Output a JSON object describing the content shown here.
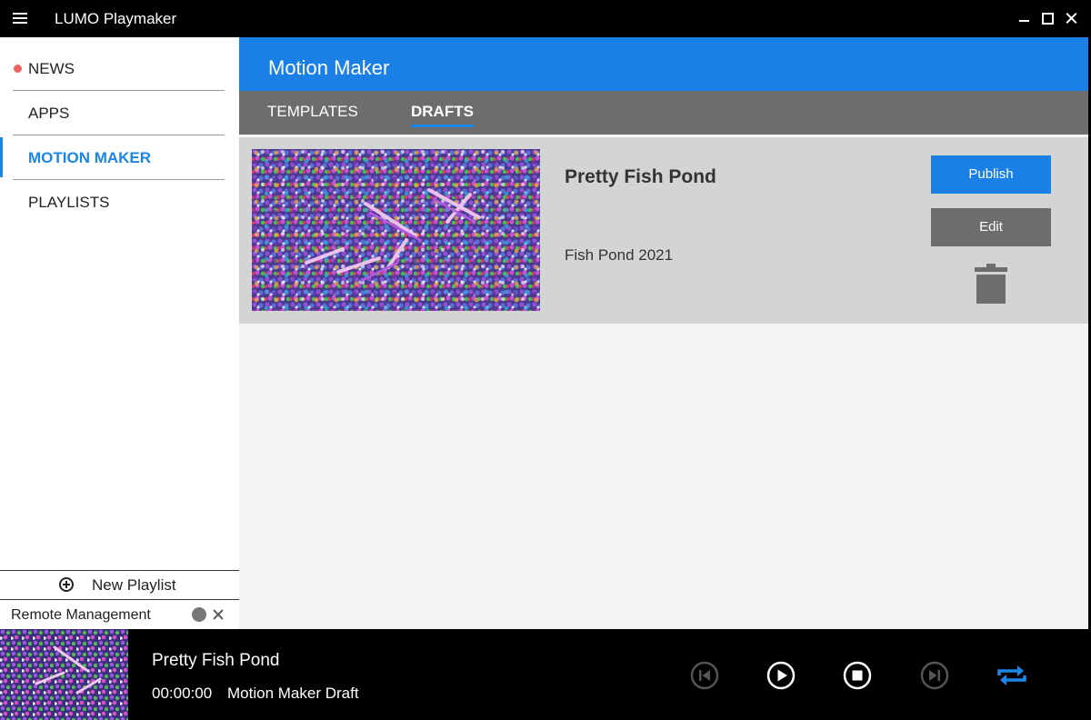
{
  "window": {
    "title": "LUMO Playmaker",
    "icons": [
      "hamburger-menu-icon",
      "minimize-icon",
      "maximize-icon",
      "close-icon"
    ]
  },
  "sidebar": {
    "items": [
      {
        "label": "NEWS",
        "has_notification_dot": true
      },
      {
        "label": "APPS"
      },
      {
        "label": "MOTION MAKER",
        "active": true
      },
      {
        "label": "PLAYLISTS"
      }
    ],
    "new_playlist_label": "New Playlist",
    "remote_management_label": "Remote Management"
  },
  "main": {
    "title": "Motion Maker",
    "tabs": [
      {
        "label": "TEMPLATES"
      },
      {
        "label": "DRAFTS",
        "active": true
      }
    ],
    "drafts": [
      {
        "name": "Pretty Fish Pond",
        "subtitle": "Fish Pond 2021",
        "publish_label": "Publish",
        "edit_label": "Edit"
      }
    ]
  },
  "player": {
    "title": "Pretty Fish Pond",
    "time": "00:00:00",
    "subtitle": "Motion Maker Draft",
    "controls": [
      "previous-icon",
      "play-icon",
      "stop-icon",
      "next-icon",
      "repeat-icon"
    ]
  },
  "colors": {
    "accent": "#1a80e6",
    "tab_bar": "#6d6d6d",
    "card_bg": "#d3d4d4",
    "notification_dot": "#f06262"
  }
}
